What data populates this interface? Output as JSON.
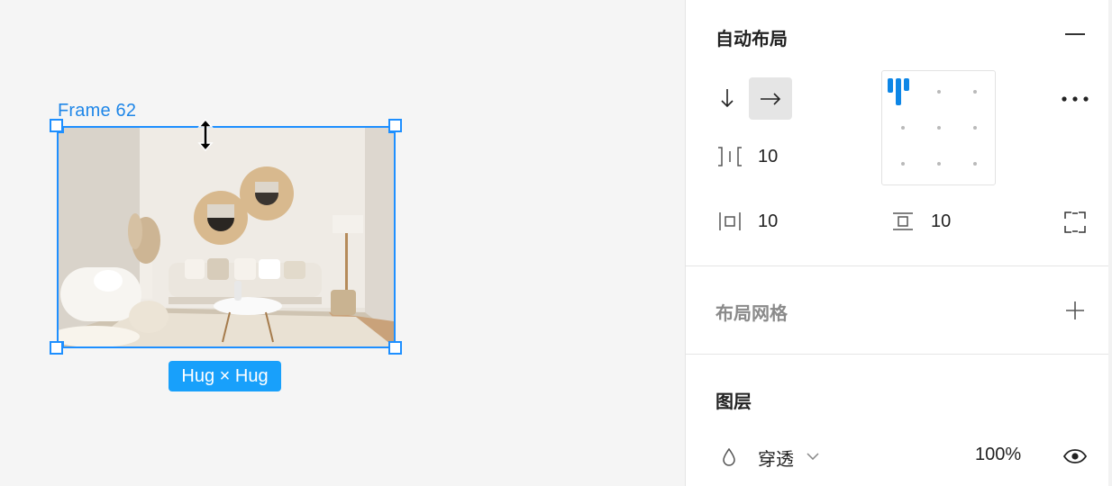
{
  "canvas": {
    "frame_label": "Frame 62",
    "size_badge": "Hug × Hug"
  },
  "panel": {
    "auto_layout": {
      "title": "自动布局",
      "spacing_between": "10",
      "padding_horizontal": "10",
      "padding_vertical": "10"
    },
    "layout_grid": {
      "title": "布局网格"
    },
    "layers": {
      "title": "图层",
      "blend_mode": "穿透",
      "opacity": "100%"
    }
  },
  "colors": {
    "accent": "#18a0fb",
    "selection": "#1e8fff",
    "alignment_active": "#0d86e6"
  }
}
